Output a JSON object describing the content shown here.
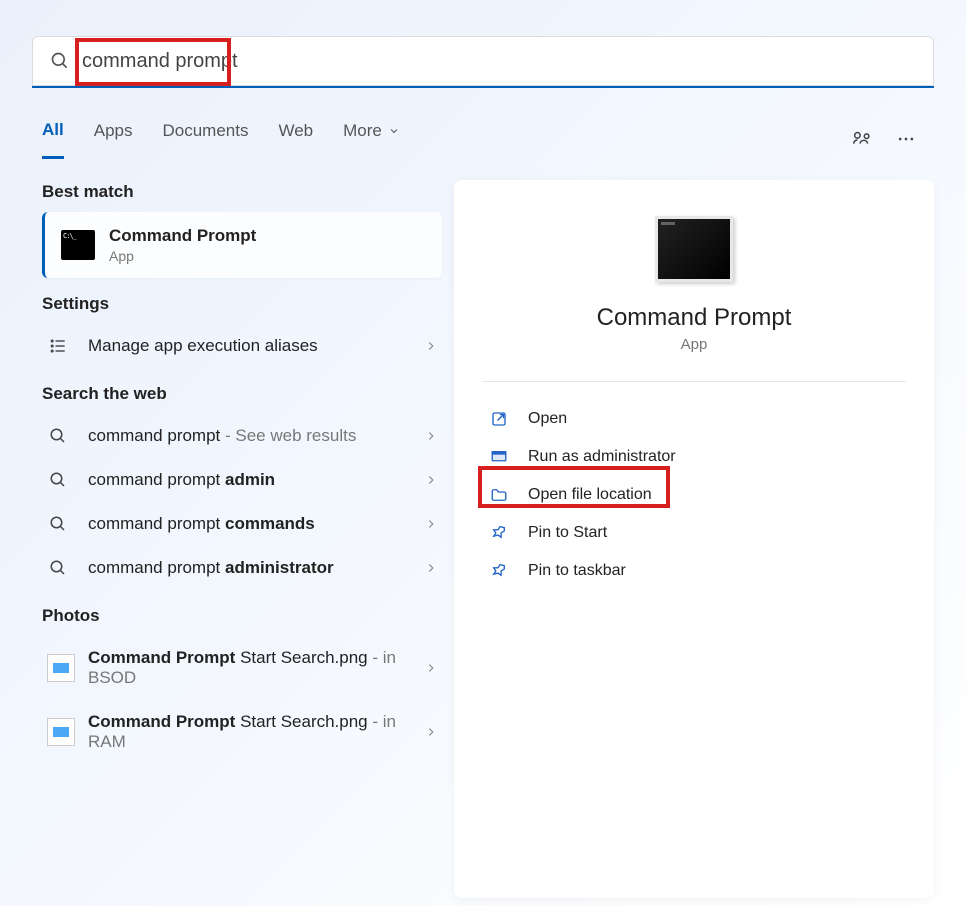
{
  "search": {
    "value": "command prompt"
  },
  "tabs": [
    "All",
    "Apps",
    "Documents",
    "Web",
    "More"
  ],
  "tabs_active": 0,
  "section_best": "Best match",
  "best_match": {
    "name": "Command Prompt",
    "sub": "App"
  },
  "section_settings": "Settings",
  "settings_rows": [
    {
      "label": "Manage app execution aliases"
    }
  ],
  "section_web": "Search the web",
  "web_rows": [
    {
      "prefix": "command prompt",
      "suffix": " - See web results"
    },
    {
      "prefix": "command prompt ",
      "bold": "admin"
    },
    {
      "prefix": "command prompt ",
      "bold": "commands"
    },
    {
      "prefix": "command prompt ",
      "bold": "administrator"
    }
  ],
  "section_photos": "Photos",
  "photo_rows": [
    {
      "bold": "Command Prompt",
      "cont": " Start Search.png",
      "loc": " - in BSOD"
    },
    {
      "bold": "Command Prompt",
      "cont": " Start Search.png",
      "loc": " - in RAM"
    }
  ],
  "detail": {
    "title": "Command Prompt",
    "subtitle": "App",
    "actions": [
      {
        "icon": "open",
        "label": "Open"
      },
      {
        "icon": "admin",
        "label": "Run as administrator"
      },
      {
        "icon": "folder",
        "label": "Open file location"
      },
      {
        "icon": "pin",
        "label": "Pin to Start"
      },
      {
        "icon": "pin",
        "label": "Pin to taskbar"
      }
    ]
  }
}
